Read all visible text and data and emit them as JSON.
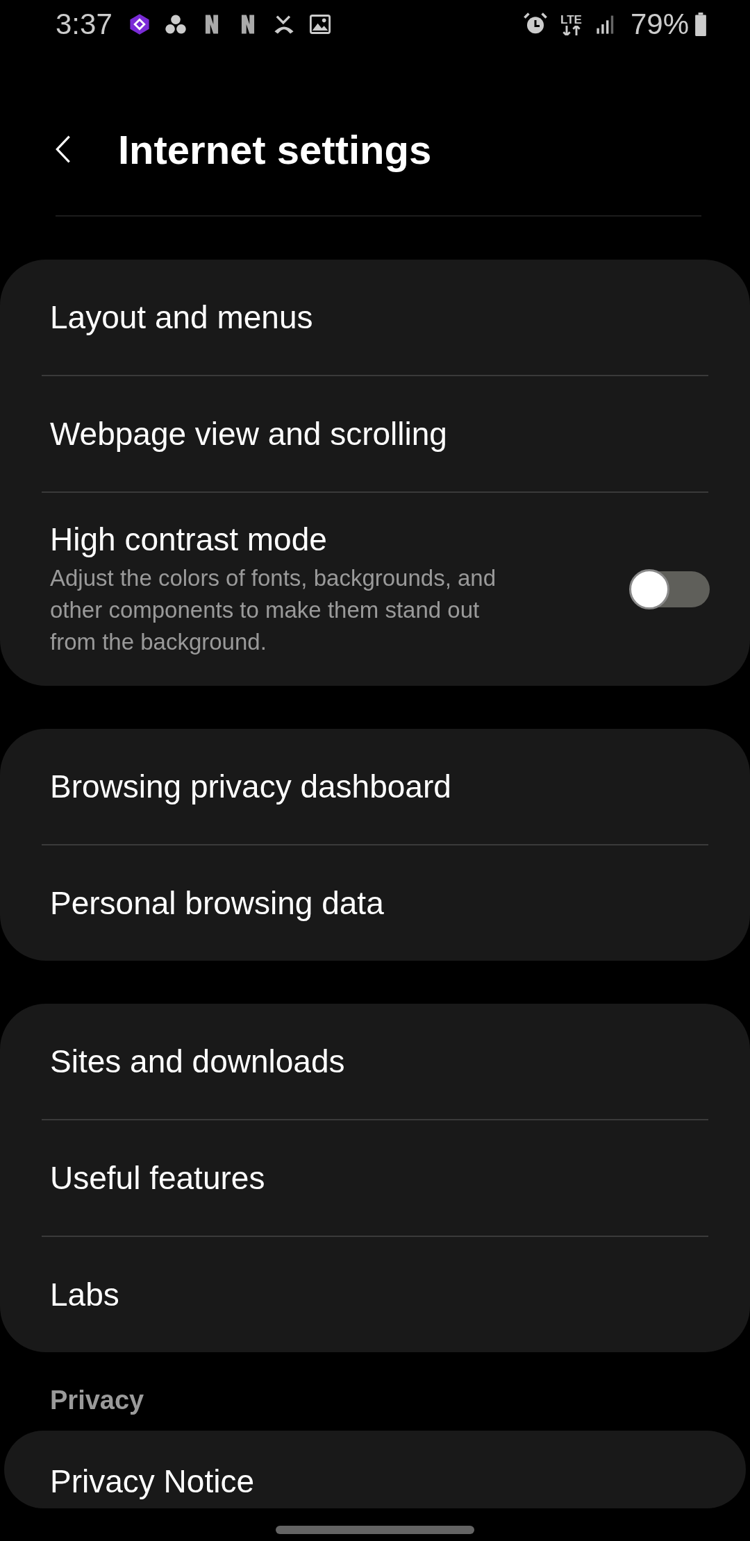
{
  "status_bar": {
    "time": "3:37",
    "network": "LTE",
    "battery": "79%"
  },
  "header": {
    "title": "Internet settings"
  },
  "groups": [
    {
      "items": [
        {
          "kind": "link",
          "title": "Layout and menus"
        },
        {
          "kind": "link",
          "title": "Webpage view and scrolling"
        },
        {
          "kind": "toggle",
          "title": "High contrast mode",
          "description": "Adjust the colors of fonts, backgrounds, and other components to make them stand out from the background.",
          "on": false
        }
      ]
    },
    {
      "items": [
        {
          "kind": "link",
          "title": "Browsing privacy dashboard"
        },
        {
          "kind": "link",
          "title": "Personal browsing data"
        }
      ]
    },
    {
      "items": [
        {
          "kind": "link",
          "title": "Sites and downloads"
        },
        {
          "kind": "link",
          "title": "Useful features"
        },
        {
          "kind": "link",
          "title": "Labs"
        }
      ]
    },
    {
      "header": "Privacy",
      "items": [
        {
          "kind": "link",
          "title": "Privacy Notice"
        }
      ]
    }
  ]
}
